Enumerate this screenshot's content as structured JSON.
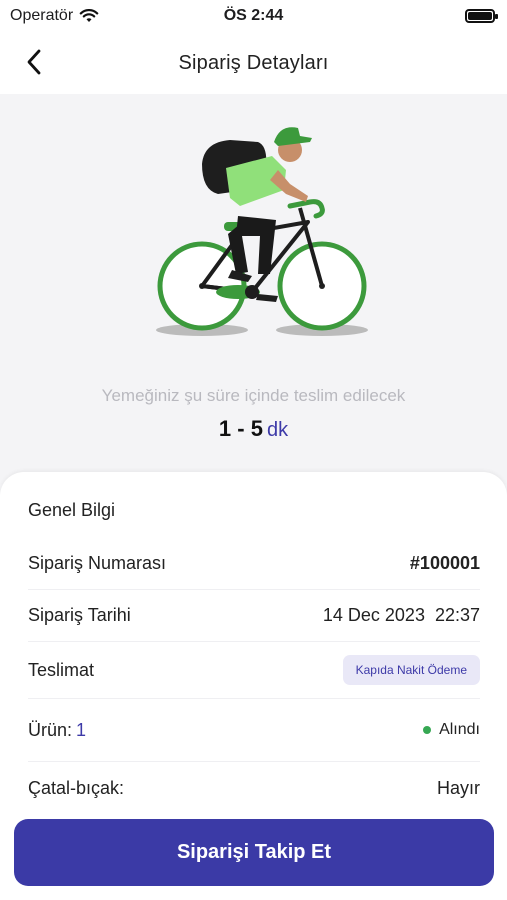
{
  "status_bar": {
    "carrier": "Operatör",
    "time": "ÖS 2:44"
  },
  "nav": {
    "title": "Sipariş Detayları"
  },
  "delivery": {
    "caption": "Yemeğiniz şu süre içinde teslim edilecek",
    "range": "1 - 5",
    "unit": "dk"
  },
  "info": {
    "section_title": "Genel Bilgi",
    "order_number_label": "Sipariş Numarası",
    "order_number": "#100001",
    "order_date_label": "Sipariş Tarihi",
    "order_date": "14 Dec 2023  22:37",
    "delivery_label": "Teslimat",
    "delivery_method": "Kapıda Nakit Ödeme",
    "product_label": "Ürün:",
    "product_count": "1",
    "product_status": "Alındı",
    "cutlery_label": "Çatal-bıçak:",
    "cutlery_value": "Hayır"
  },
  "cta": {
    "label": "Siparişi Takip Et"
  },
  "colors": {
    "accent": "#3b3aa6",
    "status_ok": "#36a853",
    "bike_green": "#3c9a3c"
  }
}
